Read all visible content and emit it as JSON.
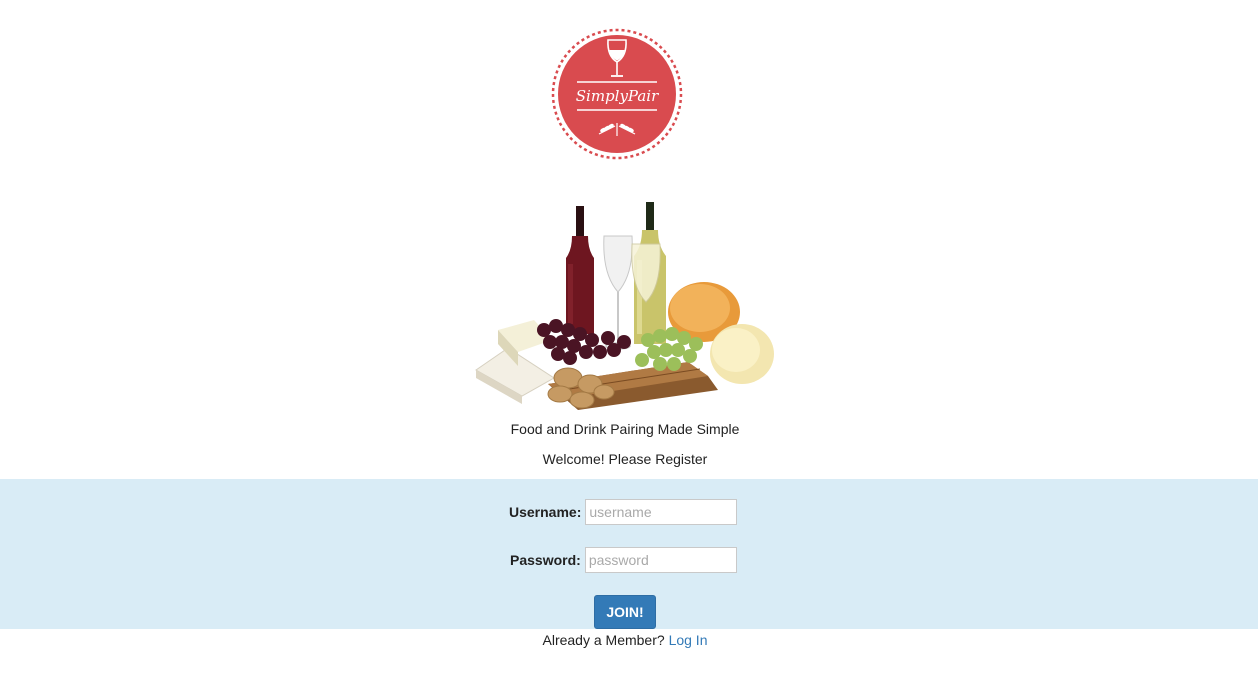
{
  "brand": {
    "name": "SimplyPair",
    "accent": "#d94b4f"
  },
  "tagline": "Food and Drink Pairing Made Simple",
  "welcome": "Welcome! Please Register",
  "form": {
    "username_label": "Username:",
    "username_placeholder": "username",
    "username_value": "",
    "password_label": "Password:",
    "password_placeholder": "password",
    "password_value": "",
    "submit_label": "JOIN!",
    "band_color": "#d9ecf6",
    "button_color": "#337ab7"
  },
  "footer": {
    "prompt": "Already a Member?",
    "login_label": "Log In"
  },
  "icons": {
    "logo_top": "wine-glass-icon",
    "logo_bottom": "wheat-icon"
  }
}
